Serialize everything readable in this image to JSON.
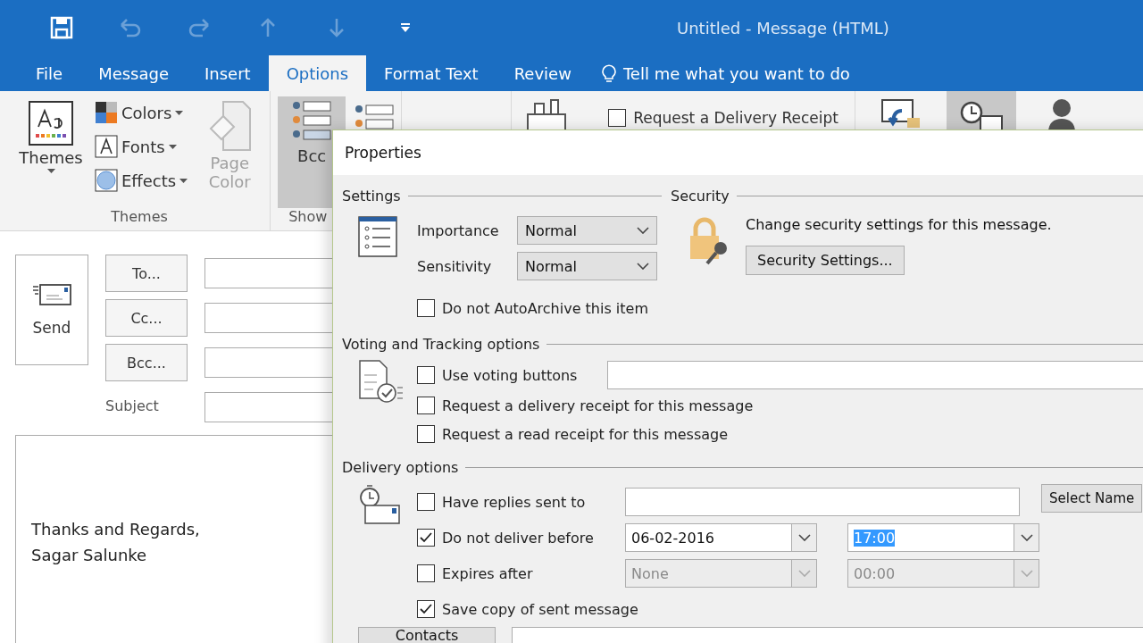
{
  "window": {
    "title": "Untitled - Message (HTML)"
  },
  "quick_access": [
    {
      "kind": "save",
      "disabled": false
    },
    {
      "kind": "undo",
      "disabled": true
    },
    {
      "kind": "redo",
      "disabled": true
    },
    {
      "kind": "up",
      "disabled": true
    },
    {
      "kind": "down",
      "disabled": true
    },
    {
      "kind": "customize",
      "disabled": false
    }
  ],
  "tabs": [
    {
      "label": "File",
      "selected": false
    },
    {
      "label": "Message",
      "selected": false
    },
    {
      "label": "Insert",
      "selected": false
    },
    {
      "label": "Options",
      "selected": true
    },
    {
      "label": "Format Text",
      "selected": false
    },
    {
      "label": "Review",
      "selected": false
    }
  ],
  "tell_me": "Tell me what you want to do",
  "ribbon": {
    "themes_group": {
      "label": "Themes",
      "themes_button": "Themes",
      "menus": [
        {
          "kind": "colors",
          "label": "Colors"
        },
        {
          "kind": "fonts",
          "label": "Fonts"
        },
        {
          "kind": "effects",
          "label": "Effects"
        }
      ],
      "page_color": {
        "label": "Page Color",
        "disabled": true
      }
    },
    "show_group": {
      "label": "Show",
      "bcc": {
        "label": "Bcc",
        "selected": true
      }
    },
    "delivery_receipt": {
      "label": "Request a Delivery Receipt",
      "checked": false
    },
    "delay_delivery": {
      "selected": true
    }
  },
  "compose": {
    "send": "Send",
    "address_buttons": [
      "To...",
      "Cc...",
      "Bcc..."
    ],
    "subject_label": "Subject",
    "body": [
      "Thanks and Regards,",
      "Sagar Salunke"
    ]
  },
  "dialog": {
    "title": "Properties",
    "settings": {
      "heading": "Settings",
      "selects": [
        {
          "label": "Importance",
          "value": "Normal"
        },
        {
          "label": "Sensitivity",
          "value": "Normal"
        }
      ],
      "autoarchive": {
        "label": "Do not AutoArchive this item",
        "checked": false
      }
    },
    "security": {
      "heading": "Security",
      "text": "Change security settings for this message.",
      "button": "Security Settings..."
    },
    "voting": {
      "heading": "Voting and Tracking options",
      "options": [
        {
          "kind": "field",
          "label": "Use voting buttons",
          "checked": false
        },
        {
          "kind": "plain",
          "label": "Request a delivery receipt for this message",
          "checked": false
        },
        {
          "kind": "plain",
          "label": "Request a read receipt for this message",
          "checked": false
        }
      ]
    },
    "delivery": {
      "heading": "Delivery options",
      "options": [
        {
          "kind": "recipient",
          "label": "Have replies sent to",
          "checked": false,
          "button": "Select Name"
        },
        {
          "kind": "datetime",
          "label": "Do not deliver before",
          "checked": true,
          "date": "06-02-2016",
          "time": "17:00",
          "disabled": false,
          "time_selected": true
        },
        {
          "kind": "datetime",
          "label": "Expires after",
          "checked": false,
          "date": "None",
          "time": "00:00",
          "disabled": true,
          "time_selected": false
        },
        {
          "kind": "plain",
          "label": "Save copy of sent message",
          "checked": true
        }
      ],
      "contacts_button": "Contacts"
    }
  }
}
